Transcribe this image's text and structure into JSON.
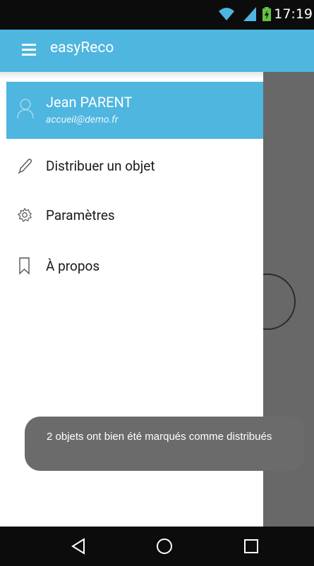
{
  "status_bar": {
    "time": "17:19",
    "icons": [
      "wifi-icon",
      "signal-icon",
      "battery-charging-icon"
    ]
  },
  "app_bar": {
    "title": "easyReco",
    "menu_icon": "hamburger-menu-icon"
  },
  "drawer": {
    "header": {
      "user_name": "Jean PARENT",
      "user_email": "accueil@demo.fr",
      "icon": "user-icon"
    },
    "items": [
      {
        "label": "Distribuer un objet",
        "icon": "pencil-icon"
      },
      {
        "label": "Paramètres",
        "icon": "gear-icon"
      },
      {
        "label": "À propos",
        "icon": "bookmark-icon"
      }
    ]
  },
  "toast": {
    "message": "2 objets ont bien été marqués comme distribués"
  },
  "nav_bar": {
    "buttons": [
      "back-icon",
      "home-icon",
      "recents-icon"
    ]
  },
  "colors": {
    "primary": "#4eb6df",
    "scrim": "#686868",
    "toast": "#6b6b6b",
    "system_bar": "#0c0c0c"
  }
}
